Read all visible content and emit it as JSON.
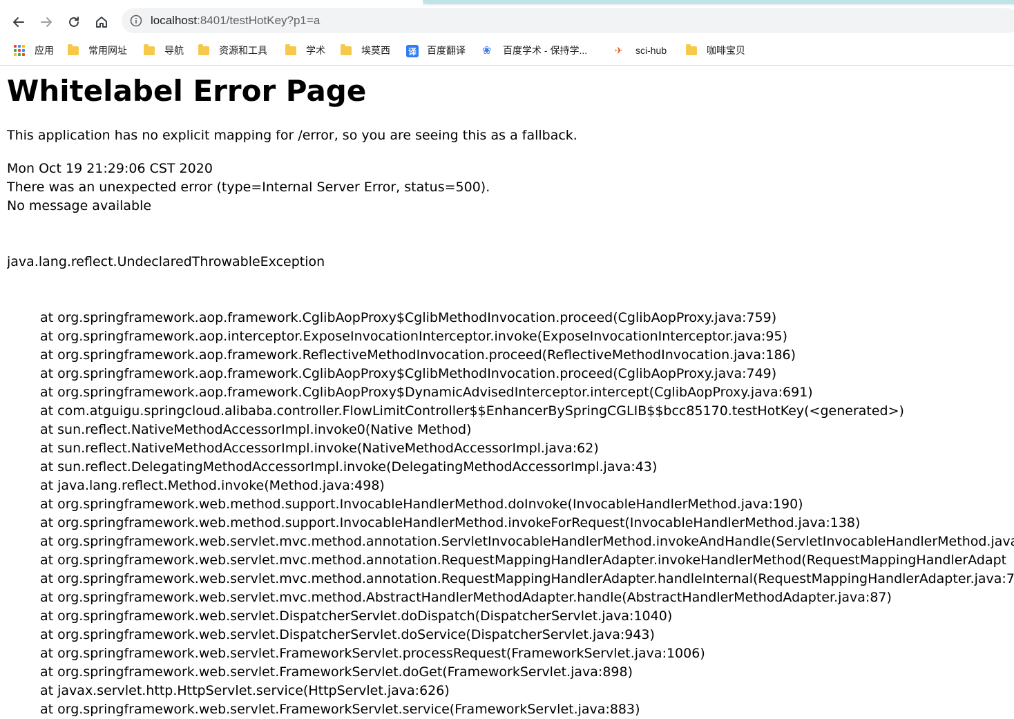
{
  "browser": {
    "url_host": "localhost",
    "url_rest": ":8401/testHotKey?p1=a",
    "buttons": {
      "back": "arrow-left-icon",
      "forward": "arrow-right-icon",
      "reload": "reload-icon",
      "home": "home-icon"
    }
  },
  "bookmarks": [
    {
      "label": "应用",
      "icon": "apps-icon"
    },
    {
      "label": "常用网址",
      "icon": "folder-icon"
    },
    {
      "label": "导航",
      "icon": "folder-icon"
    },
    {
      "label": "资源和工具",
      "icon": "folder-icon"
    },
    {
      "label": "学术",
      "icon": "folder-icon"
    },
    {
      "label": "埃莫西",
      "icon": "folder-icon"
    },
    {
      "label": "百度翻译",
      "icon": "translate-icon"
    },
    {
      "label": "百度学术 - 保持学...",
      "icon": "baidu-paw-icon"
    },
    {
      "label": "sci-hub",
      "icon": "scihub-bird-icon"
    },
    {
      "label": "咖啡宝贝",
      "icon": "folder-icon"
    }
  ],
  "page": {
    "title": "Whitelabel Error Page",
    "fallback_text": "This application has no explicit mapping for /error, so you are seeing this as a fallback.",
    "timestamp": "Mon Oct 19 21:29:06 CST 2020",
    "error_line": "There was an unexpected error (type=Internal Server Error, status=500).",
    "message": "No message available",
    "exception": "java.lang.reflect.UndeclaredThrowableException",
    "frames": [
      "at org.springframework.aop.framework.CglibAopProxy$CglibMethodInvocation.proceed(CglibAopProxy.java:759)",
      "at org.springframework.aop.interceptor.ExposeInvocationInterceptor.invoke(ExposeInvocationInterceptor.java:95)",
      "at org.springframework.aop.framework.ReflectiveMethodInvocation.proceed(ReflectiveMethodInvocation.java:186)",
      "at org.springframework.aop.framework.CglibAopProxy$CglibMethodInvocation.proceed(CglibAopProxy.java:749)",
      "at org.springframework.aop.framework.CglibAopProxy$DynamicAdvisedInterceptor.intercept(CglibAopProxy.java:691)",
      "at com.atguigu.springcloud.alibaba.controller.FlowLimitController$$EnhancerBySpringCGLIB$$bcc85170.testHotKey(<generated>)",
      "at sun.reflect.NativeMethodAccessorImpl.invoke0(Native Method)",
      "at sun.reflect.NativeMethodAccessorImpl.invoke(NativeMethodAccessorImpl.java:62)",
      "at sun.reflect.DelegatingMethodAccessorImpl.invoke(DelegatingMethodAccessorImpl.java:43)",
      "at java.lang.reflect.Method.invoke(Method.java:498)",
      "at org.springframework.web.method.support.InvocableHandlerMethod.doInvoke(InvocableHandlerMethod.java:190)",
      "at org.springframework.web.method.support.InvocableHandlerMethod.invokeForRequest(InvocableHandlerMethod.java:138)",
      "at org.springframework.web.servlet.mvc.method.annotation.ServletInvocableHandlerMethod.invokeAndHandle(ServletInvocableHandlerMethod.java",
      "at org.springframework.web.servlet.mvc.method.annotation.RequestMappingHandlerAdapter.invokeHandlerMethod(RequestMappingHandlerAdapt",
      "at org.springframework.web.servlet.mvc.method.annotation.RequestMappingHandlerAdapter.handleInternal(RequestMappingHandlerAdapter.java:7",
      "at org.springframework.web.servlet.mvc.method.AbstractHandlerMethodAdapter.handle(AbstractHandlerMethodAdapter.java:87)",
      "at org.springframework.web.servlet.DispatcherServlet.doDispatch(DispatcherServlet.java:1040)",
      "at org.springframework.web.servlet.DispatcherServlet.doService(DispatcherServlet.java:943)",
      "at org.springframework.web.servlet.FrameworkServlet.processRequest(FrameworkServlet.java:1006)",
      "at org.springframework.web.servlet.FrameworkServlet.doGet(FrameworkServlet.java:898)",
      "at javax.servlet.http.HttpServlet.service(HttpServlet.java:626)",
      "at org.springframework.web.servlet.FrameworkServlet.service(FrameworkServlet.java:883)"
    ]
  },
  "colors": {
    "tab_strip": "#bfe4e6",
    "omnibox_bg": "#f1f3f4",
    "folder": "#f6c94a",
    "translate_icon": "#2f7cf6"
  }
}
